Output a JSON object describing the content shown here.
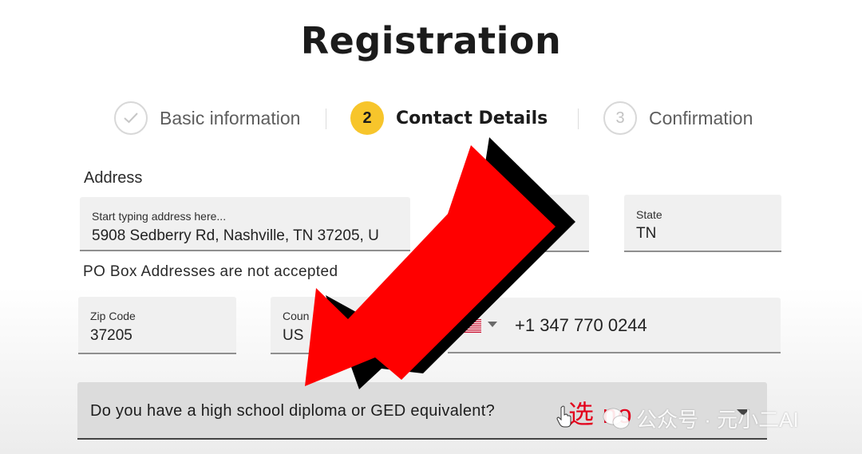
{
  "page": {
    "title": "Registration"
  },
  "steps": [
    {
      "index": "✓",
      "label": "Basic information",
      "state": "done"
    },
    {
      "index": "2",
      "label": "Contact Details",
      "state": "active"
    },
    {
      "index": "3",
      "label": "Confirmation",
      "state": "todo"
    }
  ],
  "address": {
    "section_label": "Address",
    "street_placeholder": "Start typing address here...",
    "street_value": "5908 Sedberry Rd, Nashville, TN 37205, U",
    "state_label": "State",
    "state_value": "TN",
    "po_note": "PO Box Addresses are not accepted",
    "zip_label": "Zip Code",
    "zip_value": "37205",
    "country_label": "Coun",
    "country_value": "US"
  },
  "phone": {
    "flag": "us-flag-icon",
    "value": "+1 347 770 0244"
  },
  "question": {
    "text": "Do you have a high school diploma or GED equivalent?"
  },
  "annotation": {
    "text": "选 no"
  },
  "watermark": {
    "text": "公众号 · 元小二AI",
    "icon": "wechat-icon"
  },
  "colors": {
    "accent": "#f7c52b",
    "arrow": "#ff0000",
    "annotation": "#e3001b"
  }
}
